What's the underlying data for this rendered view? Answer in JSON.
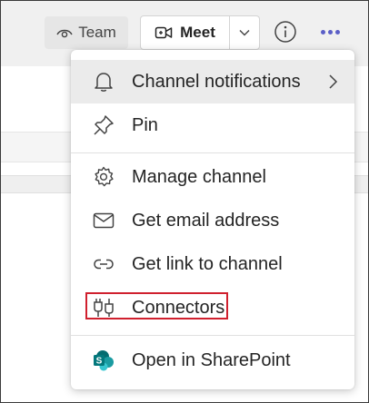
{
  "header": {
    "team_label": "Team",
    "meet_label": "Meet",
    "accent_color": "#5b5fc7"
  },
  "menu": {
    "items": [
      {
        "label": "Channel notifications",
        "icon": "bell-icon",
        "has_submenu": true
      },
      {
        "label": "Pin",
        "icon": "pin-icon"
      },
      {
        "label": "Manage channel",
        "icon": "gear-icon"
      },
      {
        "label": "Get email address",
        "icon": "mail-icon"
      },
      {
        "label": "Get link to channel",
        "icon": "link-icon"
      },
      {
        "label": "Connectors",
        "icon": "connectors-icon",
        "highlighted": true
      },
      {
        "label": "Open in SharePoint",
        "icon": "sharepoint-icon"
      }
    ],
    "highlight_color": "#d0202e"
  }
}
